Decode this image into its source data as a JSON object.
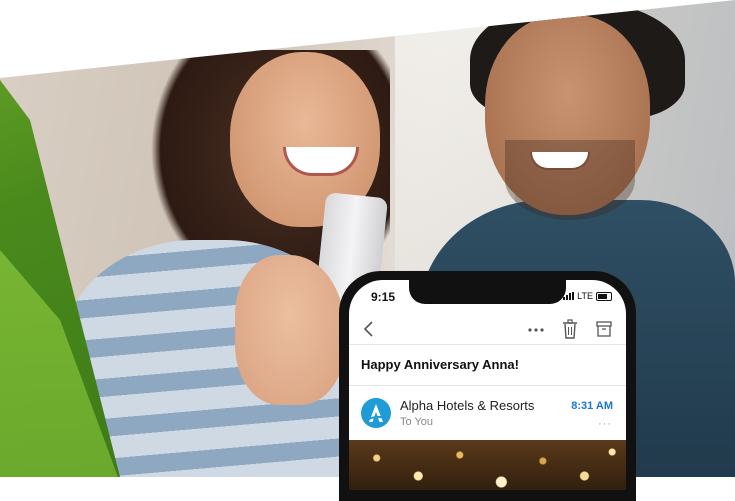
{
  "status_bar": {
    "time": "9:15",
    "network": "LTE"
  },
  "toolbar": {
    "back_icon": "chevron-left-icon",
    "more_icon": "ellipsis-icon",
    "trash_icon": "trash-icon",
    "archive_icon": "archive-icon"
  },
  "email": {
    "subject": "Happy Anniversary Anna!",
    "sender": "Alpha Hotels & Resorts",
    "recipient": "To You",
    "time": "8:31 AM",
    "more": "···",
    "avatar_letter": "A"
  },
  "colors": {
    "accent_blue": "#1a73d9",
    "avatar_blue": "#1f9bd6",
    "brand_green": "#6aa52a"
  }
}
